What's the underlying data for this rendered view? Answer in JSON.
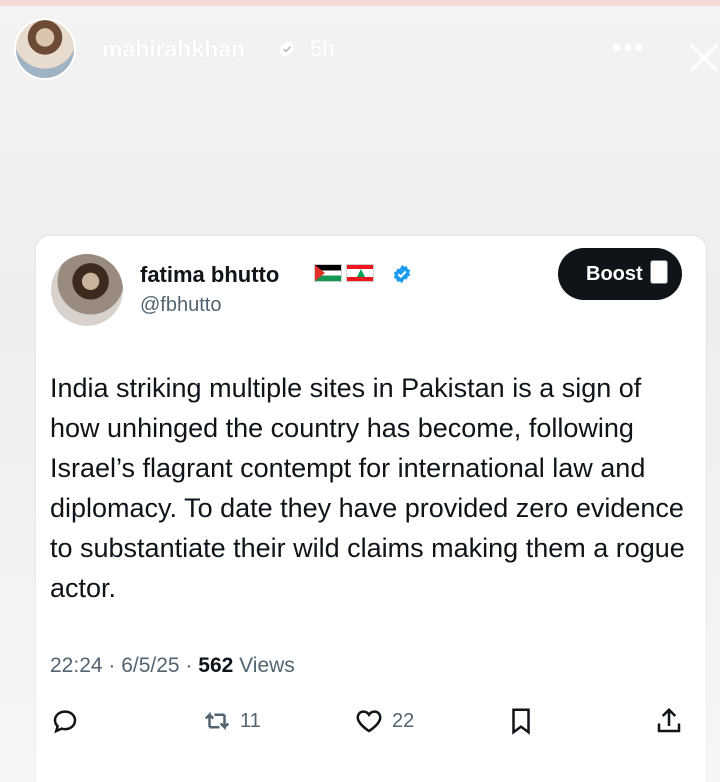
{
  "story": {
    "username": "mahirahkhan",
    "time": "5h"
  },
  "tweet": {
    "author_name": "fatima bhutto",
    "handle": "@fbhutto",
    "boost_label": "Boost",
    "text": "India striking multiple sites in Pakistan is a sign of how unhinged the country has become, following Israel’s flagrant contempt for international law and diplomacy. To date they have provided zero evidence to substantiate their wild claims making them a rogue actor.",
    "timestamp": "22:24 · 6/5/25 ·",
    "views_count": "562",
    "views_label": "Views",
    "retweets": "11",
    "likes": "22"
  },
  "colors": {
    "verified_blue": "#1d9bf0",
    "text_primary": "#0f1419",
    "text_secondary": "#536471"
  }
}
